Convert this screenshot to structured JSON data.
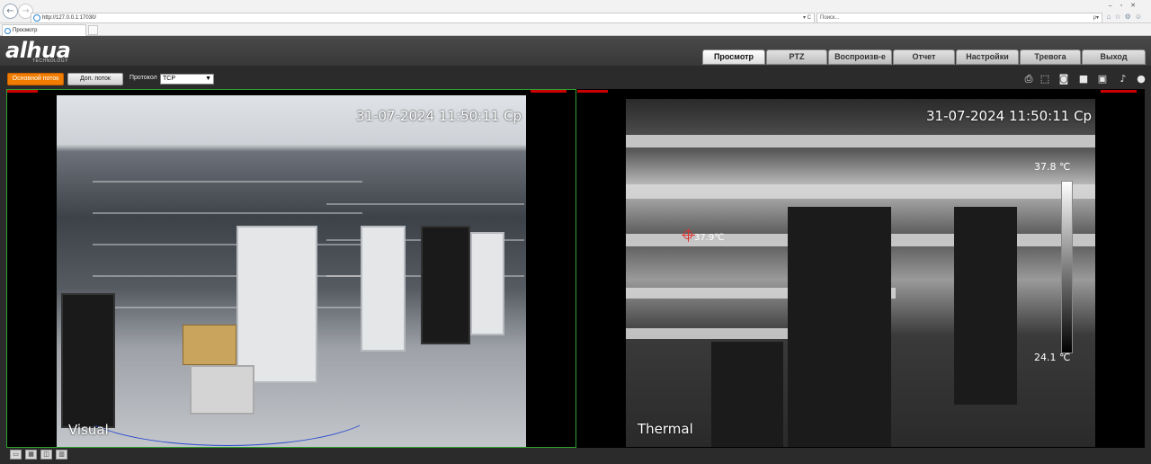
{
  "browser": {
    "address": "http://127.0.0.1:17030/",
    "address_controls": "▾ C",
    "search_placeholder": "Поиск...",
    "search_controls": "ρ▾",
    "tab_title": "Просмотр"
  },
  "app": {
    "logo": "alhua",
    "logo_sub": "TECHNOLOGY",
    "tabs": [
      {
        "label": "Просмотр",
        "active": true
      },
      {
        "label": "PTZ",
        "active": false
      },
      {
        "label": "Воспроизв-е",
        "active": false
      },
      {
        "label": "Отчет",
        "active": false
      },
      {
        "label": "Настройки",
        "active": false
      },
      {
        "label": "Тревога",
        "active": false
      },
      {
        "label": "Выход",
        "active": false
      }
    ]
  },
  "toolbar": {
    "main_stream": "Основной поток",
    "sub_stream": "Доп. поток",
    "protocol_label": "Протокол",
    "protocol_value": "TCP",
    "icons": [
      "printer-icon",
      "region-snapshot-icon",
      "camera-snapshot-icon",
      "record-icon",
      "multi-record-icon",
      "audio-icon",
      "microphone-icon"
    ]
  },
  "visual_feed": {
    "timestamp": "31-07-2024 11:50:11 Ср",
    "channel_name": "Visual"
  },
  "thermal_feed": {
    "timestamp": "31-07-2024 11:50:11 Ср",
    "channel_name": "Thermal",
    "temp_max": "37.8 ℃",
    "temp_min": "24.1 ℃",
    "spot_temp": "37.9℃"
  },
  "colors": {
    "accent_orange": "#f07d00",
    "active_border_green": "#2fa12f",
    "marker_red": "#e03030"
  },
  "bottom_icons": [
    "fullscreen-icon",
    "window-layout-icon",
    "split-screen-icon",
    "stats-icon"
  ]
}
